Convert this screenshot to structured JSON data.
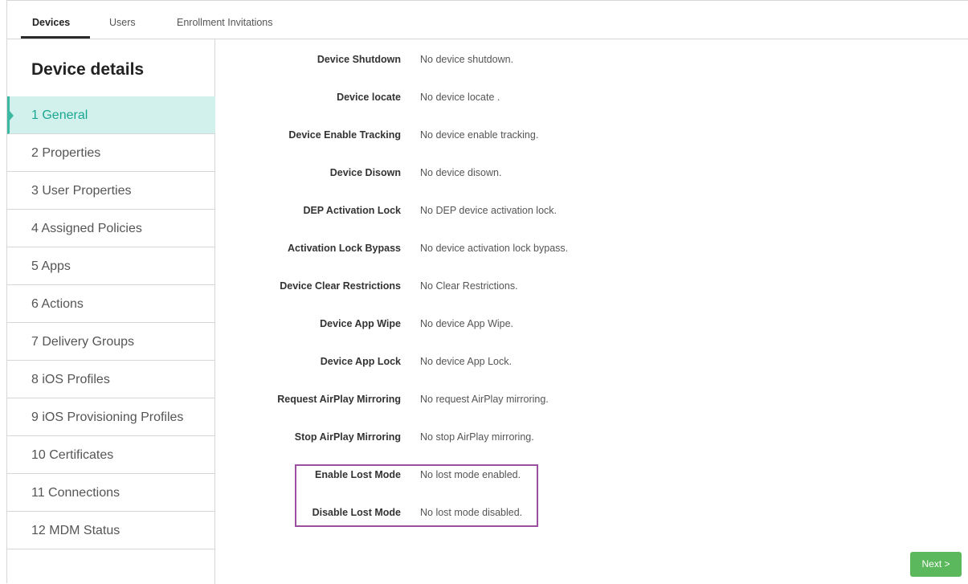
{
  "tabs": [
    {
      "label": "Devices",
      "active": true
    },
    {
      "label": "Users",
      "active": false
    },
    {
      "label": "Enrollment Invitations",
      "active": false
    }
  ],
  "sidebar": {
    "title": "Device details",
    "steps": [
      "1 General",
      "2 Properties",
      "3 User Properties",
      "4 Assigned Policies",
      "5 Apps",
      "6 Actions",
      "7 Delivery Groups",
      "8 iOS Profiles",
      "9 iOS Provisioning Profiles",
      "10 Certificates",
      "11 Connections",
      "12 MDM Status"
    ],
    "active_index": 0
  },
  "details": [
    {
      "label": "Device Shutdown",
      "value": "No device shutdown."
    },
    {
      "label": "Device locate",
      "value": "No device locate ."
    },
    {
      "label": "Device Enable Tracking",
      "value": "No device enable tracking."
    },
    {
      "label": "Device Disown",
      "value": "No device disown."
    },
    {
      "label": "DEP Activation Lock",
      "value": "No DEP device activation lock."
    },
    {
      "label": "Activation Lock Bypass",
      "value": "No device activation lock bypass."
    },
    {
      "label": "Device Clear Restrictions",
      "value": "No Clear Restrictions."
    },
    {
      "label": "Device App Wipe",
      "value": "No device App Wipe."
    },
    {
      "label": "Device App Lock",
      "value": "No device App Lock."
    },
    {
      "label": "Request AirPlay Mirroring",
      "value": "No request AirPlay mirroring."
    },
    {
      "label": "Stop AirPlay Mirroring",
      "value": "No stop AirPlay mirroring."
    },
    {
      "label": "Enable Lost Mode",
      "value": "No lost mode enabled."
    },
    {
      "label": "Disable Lost Mode",
      "value": "No lost mode disabled."
    }
  ],
  "buttons": {
    "next": "Next >"
  },
  "colors": {
    "active_step_bg": "#d2f1ec",
    "active_step_text": "#1aa792",
    "highlight_border": "#9b4f9e",
    "next_button": "#5cb85c"
  }
}
